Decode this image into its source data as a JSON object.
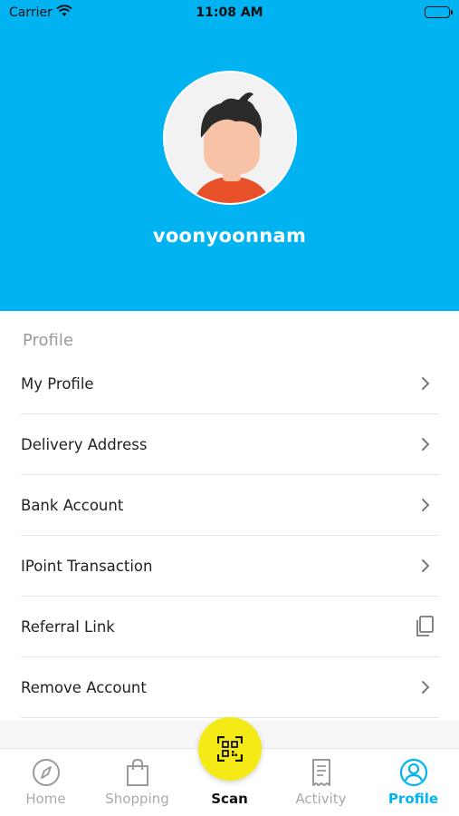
{
  "status_bar": {
    "carrier": "Carrier",
    "time": "11:08 AM"
  },
  "header": {
    "background": "#01B4F1",
    "username": "voonyoonnam"
  },
  "section": {
    "title": "Profile"
  },
  "menu": {
    "items": [
      {
        "label": "My Profile",
        "trailing_icon": "chevron-right-icon"
      },
      {
        "label": "Delivery Address",
        "trailing_icon": "chevron-right-icon"
      },
      {
        "label": "Bank Account",
        "trailing_icon": "chevron-right-icon"
      },
      {
        "label": "IPoint Transaction",
        "trailing_icon": "chevron-right-icon"
      },
      {
        "label": "Referral Link",
        "trailing_icon": "copy-icon"
      },
      {
        "label": "Remove Account",
        "trailing_icon": "chevron-right-icon"
      }
    ]
  },
  "tabbar": {
    "tabs": [
      {
        "label": "Home",
        "icon": "compass-icon"
      },
      {
        "label": "Shopping",
        "icon": "shopping-bag-icon"
      },
      {
        "label": "Scan",
        "icon": "qr-scan-icon"
      },
      {
        "label": "Activity",
        "icon": "receipt-icon"
      },
      {
        "label": "Profile",
        "icon": "user-icon"
      }
    ],
    "active": "Profile",
    "accent_color": "#01B4F1",
    "scan_color": "#F4EB16"
  }
}
